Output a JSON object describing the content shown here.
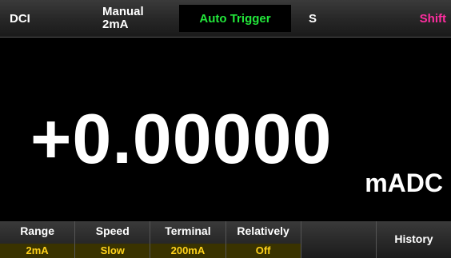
{
  "status_bar": {
    "mode": "DCI",
    "range_mode": "Manual",
    "range_value": "2mA",
    "trigger": "Auto Trigger",
    "speed": "S",
    "shift": "Shift",
    "colors": {
      "trigger": "#22e63a",
      "shift": "#ff2da0"
    }
  },
  "display": {
    "reading": "+0.00000",
    "unit": "mADC"
  },
  "softkeys": [
    {
      "label": "Range",
      "value": "2mA"
    },
    {
      "label": "Speed",
      "value": "Slow"
    },
    {
      "label": "Terminal",
      "value": "200mA"
    },
    {
      "label": "Relatively",
      "value": "Off"
    },
    {
      "label": "",
      "value": ""
    },
    {
      "label": "History",
      "value": ""
    }
  ],
  "colors": {
    "softkey_value": "#ffd21a"
  }
}
